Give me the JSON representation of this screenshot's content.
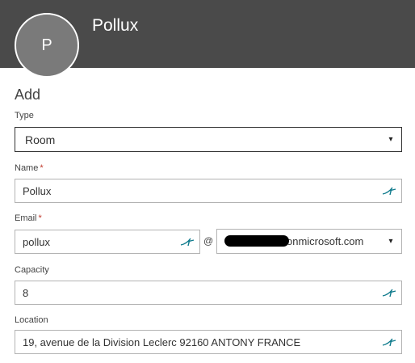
{
  "header": {
    "title": "Pollux",
    "avatar_initial": "P"
  },
  "form": {
    "section_title": "Add",
    "type": {
      "label": "Type",
      "value": "Room",
      "caret": "▾"
    },
    "name": {
      "label": "Name",
      "required_mark": "*",
      "value": "Pollux"
    },
    "email": {
      "label": "Email",
      "required_mark": "*",
      "value": "pollux",
      "at_sign": "@",
      "domain_value": "onmicrosoft.com",
      "caret": "▾"
    },
    "capacity": {
      "label": "Capacity",
      "value": "8"
    },
    "location": {
      "label": "Location",
      "value": "19, avenue de la Division Leclerc 92160 ANTONY FRANCE"
    }
  },
  "colors": {
    "header_bg": "#4a4a4a",
    "avatar_bg": "#7a7a7a",
    "autofill_icon": "#0e7a8c",
    "required": "#c0392b"
  },
  "icons": {
    "autofill": "autofill-icon"
  }
}
